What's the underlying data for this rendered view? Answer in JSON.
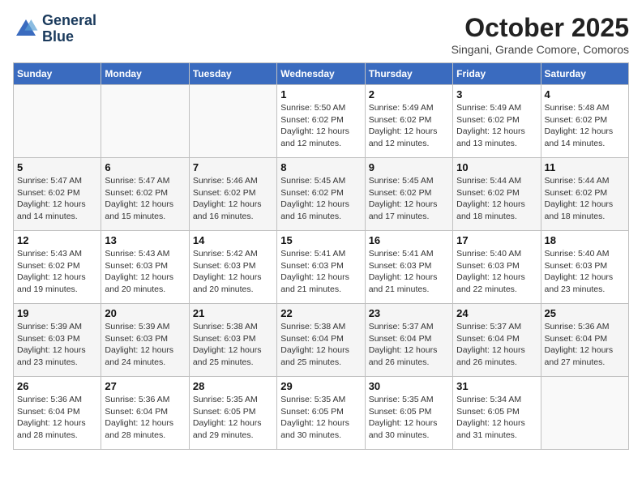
{
  "header": {
    "logo_line1": "General",
    "logo_line2": "Blue",
    "month_title": "October 2025",
    "subtitle": "Singani, Grande Comore, Comoros"
  },
  "weekdays": [
    "Sunday",
    "Monday",
    "Tuesday",
    "Wednesday",
    "Thursday",
    "Friday",
    "Saturday"
  ],
  "weeks": [
    [
      {
        "day": "",
        "info": ""
      },
      {
        "day": "",
        "info": ""
      },
      {
        "day": "",
        "info": ""
      },
      {
        "day": "1",
        "info": "Sunrise: 5:50 AM\nSunset: 6:02 PM\nDaylight: 12 hours\nand 12 minutes."
      },
      {
        "day": "2",
        "info": "Sunrise: 5:49 AM\nSunset: 6:02 PM\nDaylight: 12 hours\nand 12 minutes."
      },
      {
        "day": "3",
        "info": "Sunrise: 5:49 AM\nSunset: 6:02 PM\nDaylight: 12 hours\nand 13 minutes."
      },
      {
        "day": "4",
        "info": "Sunrise: 5:48 AM\nSunset: 6:02 PM\nDaylight: 12 hours\nand 14 minutes."
      }
    ],
    [
      {
        "day": "5",
        "info": "Sunrise: 5:47 AM\nSunset: 6:02 PM\nDaylight: 12 hours\nand 14 minutes."
      },
      {
        "day": "6",
        "info": "Sunrise: 5:47 AM\nSunset: 6:02 PM\nDaylight: 12 hours\nand 15 minutes."
      },
      {
        "day": "7",
        "info": "Sunrise: 5:46 AM\nSunset: 6:02 PM\nDaylight: 12 hours\nand 16 minutes."
      },
      {
        "day": "8",
        "info": "Sunrise: 5:45 AM\nSunset: 6:02 PM\nDaylight: 12 hours\nand 16 minutes."
      },
      {
        "day": "9",
        "info": "Sunrise: 5:45 AM\nSunset: 6:02 PM\nDaylight: 12 hours\nand 17 minutes."
      },
      {
        "day": "10",
        "info": "Sunrise: 5:44 AM\nSunset: 6:02 PM\nDaylight: 12 hours\nand 18 minutes."
      },
      {
        "day": "11",
        "info": "Sunrise: 5:44 AM\nSunset: 6:02 PM\nDaylight: 12 hours\nand 18 minutes."
      }
    ],
    [
      {
        "day": "12",
        "info": "Sunrise: 5:43 AM\nSunset: 6:02 PM\nDaylight: 12 hours\nand 19 minutes."
      },
      {
        "day": "13",
        "info": "Sunrise: 5:43 AM\nSunset: 6:03 PM\nDaylight: 12 hours\nand 20 minutes."
      },
      {
        "day": "14",
        "info": "Sunrise: 5:42 AM\nSunset: 6:03 PM\nDaylight: 12 hours\nand 20 minutes."
      },
      {
        "day": "15",
        "info": "Sunrise: 5:41 AM\nSunset: 6:03 PM\nDaylight: 12 hours\nand 21 minutes."
      },
      {
        "day": "16",
        "info": "Sunrise: 5:41 AM\nSunset: 6:03 PM\nDaylight: 12 hours\nand 21 minutes."
      },
      {
        "day": "17",
        "info": "Sunrise: 5:40 AM\nSunset: 6:03 PM\nDaylight: 12 hours\nand 22 minutes."
      },
      {
        "day": "18",
        "info": "Sunrise: 5:40 AM\nSunset: 6:03 PM\nDaylight: 12 hours\nand 23 minutes."
      }
    ],
    [
      {
        "day": "19",
        "info": "Sunrise: 5:39 AM\nSunset: 6:03 PM\nDaylight: 12 hours\nand 23 minutes."
      },
      {
        "day": "20",
        "info": "Sunrise: 5:39 AM\nSunset: 6:03 PM\nDaylight: 12 hours\nand 24 minutes."
      },
      {
        "day": "21",
        "info": "Sunrise: 5:38 AM\nSunset: 6:03 PM\nDaylight: 12 hours\nand 25 minutes."
      },
      {
        "day": "22",
        "info": "Sunrise: 5:38 AM\nSunset: 6:04 PM\nDaylight: 12 hours\nand 25 minutes."
      },
      {
        "day": "23",
        "info": "Sunrise: 5:37 AM\nSunset: 6:04 PM\nDaylight: 12 hours\nand 26 minutes."
      },
      {
        "day": "24",
        "info": "Sunrise: 5:37 AM\nSunset: 6:04 PM\nDaylight: 12 hours\nand 26 minutes."
      },
      {
        "day": "25",
        "info": "Sunrise: 5:36 AM\nSunset: 6:04 PM\nDaylight: 12 hours\nand 27 minutes."
      }
    ],
    [
      {
        "day": "26",
        "info": "Sunrise: 5:36 AM\nSunset: 6:04 PM\nDaylight: 12 hours\nand 28 minutes."
      },
      {
        "day": "27",
        "info": "Sunrise: 5:36 AM\nSunset: 6:04 PM\nDaylight: 12 hours\nand 28 minutes."
      },
      {
        "day": "28",
        "info": "Sunrise: 5:35 AM\nSunset: 6:05 PM\nDaylight: 12 hours\nand 29 minutes."
      },
      {
        "day": "29",
        "info": "Sunrise: 5:35 AM\nSunset: 6:05 PM\nDaylight: 12 hours\nand 30 minutes."
      },
      {
        "day": "30",
        "info": "Sunrise: 5:35 AM\nSunset: 6:05 PM\nDaylight: 12 hours\nand 30 minutes."
      },
      {
        "day": "31",
        "info": "Sunrise: 5:34 AM\nSunset: 6:05 PM\nDaylight: 12 hours\nand 31 minutes."
      },
      {
        "day": "",
        "info": ""
      }
    ]
  ]
}
